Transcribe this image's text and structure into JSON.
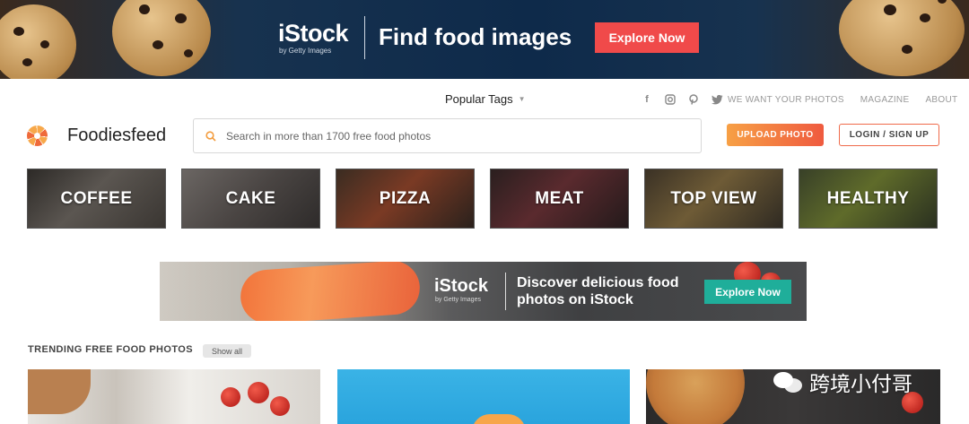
{
  "top_banner": {
    "brand": "iStock",
    "brand_sub": "by Getty Images",
    "headline": "Find food images",
    "cta": "Explore Now"
  },
  "nav": {
    "popular_tags": "Popular Tags",
    "socials": [
      "facebook-icon",
      "instagram-icon",
      "pinterest-icon",
      "twitter-icon"
    ],
    "links": [
      "WE WANT YOUR PHOTOS",
      "MAGAZINE",
      "ABOUT"
    ]
  },
  "header": {
    "brand": "Foodiesfeed",
    "search_placeholder": "Search in more than 1700 free food photos",
    "upload": "UPLOAD PHOTO",
    "login": "LOGIN / SIGN UP"
  },
  "categories": [
    "COFFEE",
    "CAKE",
    "PIZZA",
    "MEAT",
    "TOP VIEW",
    "HEALTHY"
  ],
  "mid_ad": {
    "brand": "iStock",
    "brand_sub": "by Getty Images",
    "text": "Discover delicious food photos on iStock",
    "cta": "Explore Now"
  },
  "trending": {
    "title": "TRENDING FREE FOOD PHOTOS",
    "show_all": "Show all"
  },
  "watermark": "跨境小付哥",
  "colors": {
    "accent_orange": "#f39c3d",
    "upload_gradient_start": "#f7a045",
    "upload_gradient_end": "#ef5a3f",
    "banner_cta": "#f04a4a",
    "mid_ad_cta": "#1fae9a"
  }
}
